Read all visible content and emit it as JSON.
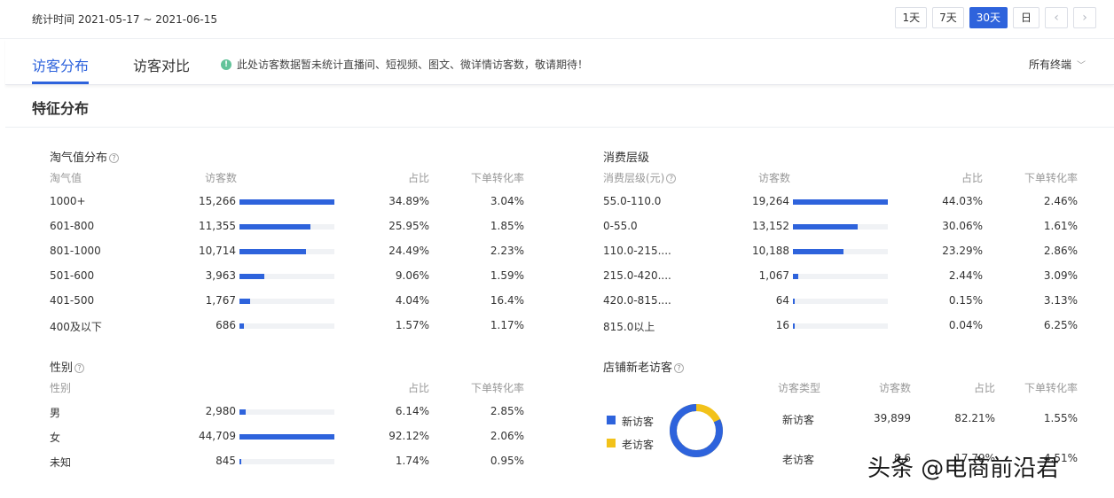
{
  "header": {
    "range_label": "统计时间 2021-05-17 ~ 2021-06-15",
    "buttons": [
      {
        "label": "1天",
        "active": false
      },
      {
        "label": "7天",
        "active": false
      },
      {
        "label": "30天",
        "active": true
      },
      {
        "label": "日",
        "active": false
      }
    ],
    "prev_icon": "chevron-left-icon",
    "next_icon": "chevron-right-icon",
    "prev_glyph": "‹",
    "next_glyph": "›"
  },
  "tabs": {
    "tab1": "访客分布",
    "tab2": "访客对比",
    "notice": "此处访客数据暂未统计直播间、短视频、图文、微详情访客数，敬请期待！",
    "terminal": "所有终端",
    "terminal_chevron": "﹀"
  },
  "section_title": "特征分布",
  "naughty": {
    "title": "淘气值分布",
    "headers": [
      "淘气值",
      "访客数",
      "占比",
      "下单转化率"
    ],
    "rows": [
      {
        "label": "1000+",
        "count": "15,266",
        "share": "34.89%",
        "conv": "3.04%",
        "fill": 1.0
      },
      {
        "label": "601-800",
        "count": "11,355",
        "share": "25.95%",
        "conv": "1.85%",
        "fill": 0.744
      },
      {
        "label": "801-1000",
        "count": "10,714",
        "share": "24.49%",
        "conv": "2.23%",
        "fill": 0.702
      },
      {
        "label": "501-600",
        "count": "3,963",
        "share": "9.06%",
        "conv": "1.59%",
        "fill": 0.26
      },
      {
        "label": "401-500",
        "count": "1,767",
        "share": "4.04%",
        "conv": "16.4%",
        "fill": 0.116
      },
      {
        "label": "400及以下",
        "count": "686",
        "share": "1.57%",
        "conv": "1.17%",
        "fill": 0.045
      }
    ]
  },
  "consumption": {
    "title": "消费层级",
    "headers": [
      "消费层级(元)",
      "访客数",
      "占比",
      "下单转化率"
    ],
    "rows": [
      {
        "label": "55.0-110.0",
        "count": "19,264",
        "share": "44.03%",
        "conv": "2.46%",
        "fill": 1.0
      },
      {
        "label": "0-55.0",
        "count": "13,152",
        "share": "30.06%",
        "conv": "1.61%",
        "fill": 0.683
      },
      {
        "label": "110.0-215....",
        "count": "10,188",
        "share": "23.29%",
        "conv": "2.86%",
        "fill": 0.529
      },
      {
        "label": "215.0-420....",
        "count": "1,067",
        "share": "2.44%",
        "conv": "3.09%",
        "fill": 0.055
      },
      {
        "label": "420.0-815....",
        "count": "64",
        "share": "0.15%",
        "conv": "3.13%",
        "fill": 0.0
      },
      {
        "label": "815.0以上",
        "count": "16",
        "share": "0.04%",
        "conv": "6.25%",
        "fill": 0.0
      }
    ]
  },
  "gender": {
    "title": "性别",
    "headers": [
      "性别",
      "占比",
      "下单转化率"
    ],
    "rows": [
      {
        "label": "男",
        "count": "2,980",
        "share": "6.14%",
        "conv": "2.85%",
        "fill": 0.067
      },
      {
        "label": "女",
        "count": "44,709",
        "share": "92.12%",
        "conv": "2.06%",
        "fill": 1.0
      },
      {
        "label": "未知",
        "count": "845",
        "share": "1.74%",
        "conv": "0.95%",
        "fill": 0.019
      }
    ]
  },
  "visitors": {
    "title": "店铺新老访客",
    "legend": [
      {
        "label": "新访客",
        "color": "#2e63dc"
      },
      {
        "label": "老访客",
        "color": "#f2c21a"
      }
    ],
    "donut_new_share": 0.8221,
    "headers": [
      "访客类型",
      "访客数",
      "占比",
      "下单转化率"
    ],
    "rows": [
      {
        "label": "新访客",
        "count": "39,899",
        "share": "82.21%",
        "conv": "1.55%"
      },
      {
        "label": "老访客",
        "count": "8,6",
        "share": "17.79%",
        "conv": "4.51%"
      }
    ]
  },
  "watermark": "头条 @电商前沿君",
  "colors": {
    "accent": "#2e63dc",
    "old_visitor": "#f2c21a"
  }
}
